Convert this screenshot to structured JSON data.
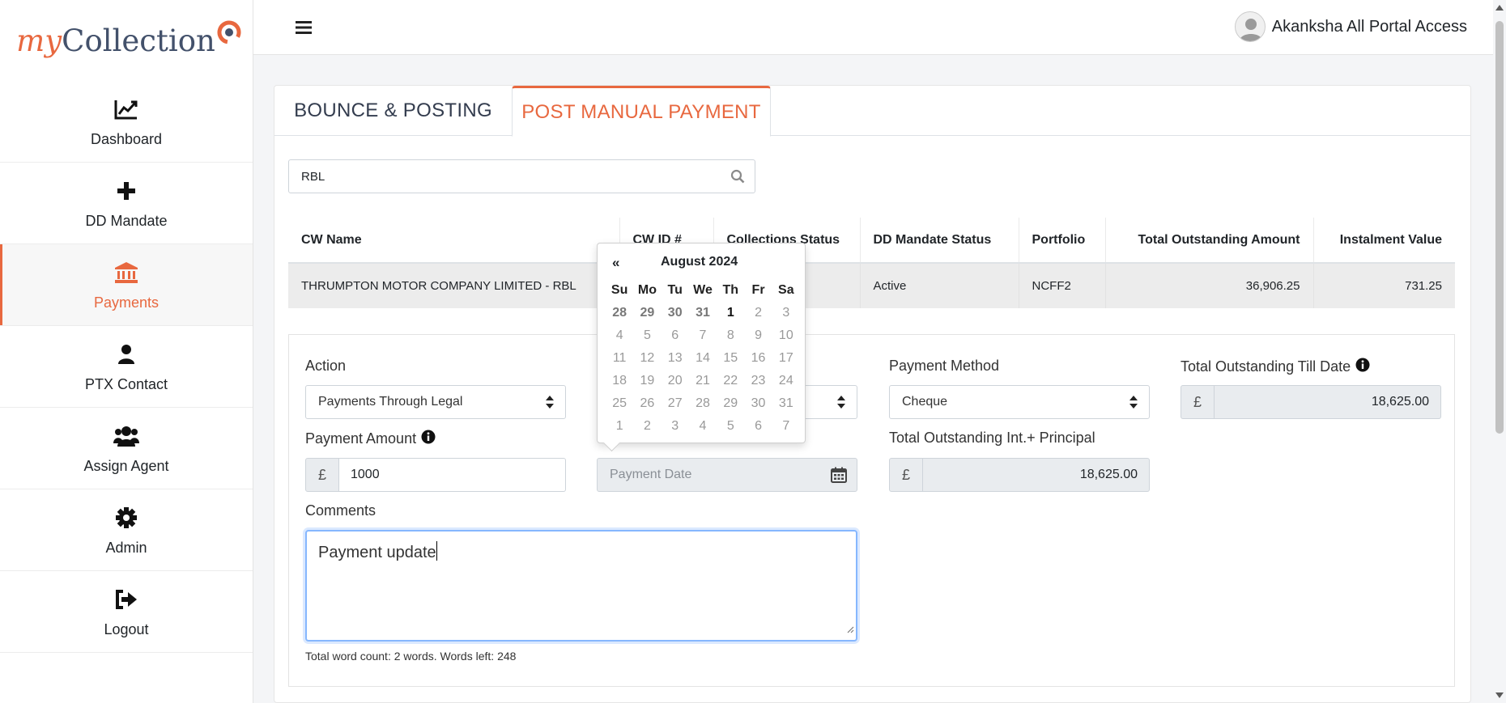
{
  "app": {
    "logo_my": "my",
    "logo_collection": "Collection",
    "brand_color": "#e8683f"
  },
  "sidebar": {
    "items": [
      {
        "label": "Dashboard",
        "icon": "chart-line-icon"
      },
      {
        "label": "DD Mandate",
        "icon": "plus-icon"
      },
      {
        "label": "Payments",
        "icon": "bank-icon",
        "active": true
      },
      {
        "label": "PTX Contact",
        "icon": "user-icon"
      },
      {
        "label": "Assign Agent",
        "icon": "users-icon"
      },
      {
        "label": "Admin",
        "icon": "gear-icon"
      },
      {
        "label": "Logout",
        "icon": "sign-out-icon"
      }
    ]
  },
  "header": {
    "user_name": "Akanksha All Portal Access"
  },
  "tabs": [
    {
      "label": "BOUNCE & POSTING"
    },
    {
      "label": "POST MANUAL PAYMENT",
      "active": true
    }
  ],
  "search": {
    "value": "RBL"
  },
  "table": {
    "headers": [
      "CW Name",
      "CW ID #",
      "Collections Status",
      "DD Mandate Status",
      "Portfolio",
      "Total Outstanding Amount",
      "Instalment Value"
    ],
    "rows": [
      [
        "THRUMPTON MOTOR COMPANY LIMITED - RBL",
        "",
        "",
        "Active",
        "NCFF2",
        "36,906.25",
        "731.25"
      ]
    ]
  },
  "form": {
    "action_label": "Action",
    "action_value": "Payments Through Legal",
    "payment_method_label": "Payment Method",
    "payment_method_value": "Cheque",
    "total_outstanding_till_date_label": "Total Outstanding Till Date",
    "total_outstanding_till_date_value": "18,625.00",
    "payment_amount_label": "Payment Amount",
    "payment_amount_value": "1000",
    "payment_date_placeholder": "Payment Date",
    "total_int_principal_label": "Total Outstanding Int.+ Principal",
    "total_int_principal_value": "18,625.00",
    "currency_symbol": "£",
    "comments_label": "Comments",
    "comments_value": "Payment update",
    "word_count": "Total word count: 2 words. Words left: 248"
  },
  "datepicker": {
    "prev": "«",
    "title": "August 2024",
    "dow": [
      "Su",
      "Mo",
      "Tu",
      "We",
      "Th",
      "Fr",
      "Sa"
    ],
    "weeks": [
      [
        "28",
        "29",
        "30",
        "31",
        "1",
        "2",
        "3"
      ],
      [
        "4",
        "5",
        "6",
        "7",
        "8",
        "9",
        "10"
      ],
      [
        "11",
        "12",
        "13",
        "14",
        "15",
        "16",
        "17"
      ],
      [
        "18",
        "19",
        "20",
        "21",
        "22",
        "23",
        "24"
      ],
      [
        "25",
        "26",
        "27",
        "28",
        "29",
        "30",
        "31"
      ],
      [
        "1",
        "2",
        "3",
        "4",
        "5",
        "6",
        "7"
      ]
    ]
  }
}
